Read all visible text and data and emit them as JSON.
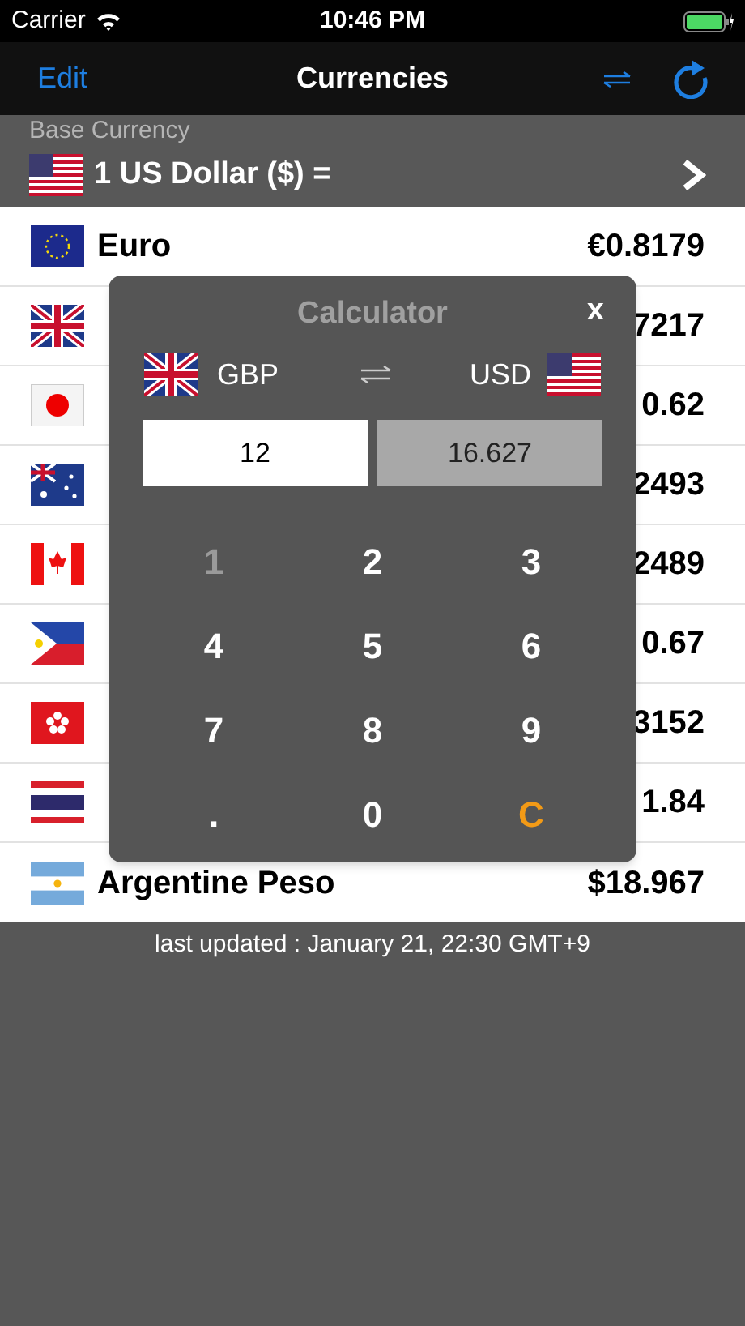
{
  "status_bar": {
    "carrier": "Carrier",
    "time": "10:46 PM"
  },
  "nav": {
    "edit": "Edit",
    "title": "Currencies"
  },
  "base": {
    "label": "Base Currency",
    "value": "1 US Dollar ($) ="
  },
  "rows": [
    {
      "name": "Euro",
      "value": "€0.8179"
    },
    {
      "value": "7217"
    },
    {
      "value": "0.62"
    },
    {
      "value": "2493"
    },
    {
      "value": "2489"
    },
    {
      "value": "0.67"
    },
    {
      "value": "3152"
    },
    {
      "value": "1.84"
    },
    {
      "name": "Argentine Peso",
      "value": "$18.967"
    }
  ],
  "footer": "last updated : January 21, 22:30 GMT+9",
  "calculator": {
    "title": "Calculator",
    "close": "x",
    "from": "GBP",
    "to": "USD",
    "input": "12",
    "result": "16.627",
    "keys": [
      {
        "label": "1",
        "kind": "digit",
        "pressed": true
      },
      {
        "label": "2",
        "kind": "digit",
        "pressed": false
      },
      {
        "label": "3",
        "kind": "digit",
        "pressed": false
      },
      {
        "label": "4",
        "kind": "digit",
        "pressed": false
      },
      {
        "label": "5",
        "kind": "digit",
        "pressed": false
      },
      {
        "label": "6",
        "kind": "digit",
        "pressed": false
      },
      {
        "label": "7",
        "kind": "digit",
        "pressed": false
      },
      {
        "label": "8",
        "kind": "digit",
        "pressed": false
      },
      {
        "label": "9",
        "kind": "digit",
        "pressed": false
      },
      {
        "label": ".",
        "kind": "digit",
        "pressed": false
      },
      {
        "label": "0",
        "kind": "digit",
        "pressed": false
      },
      {
        "label": "C",
        "kind": "clear",
        "pressed": false
      }
    ]
  }
}
